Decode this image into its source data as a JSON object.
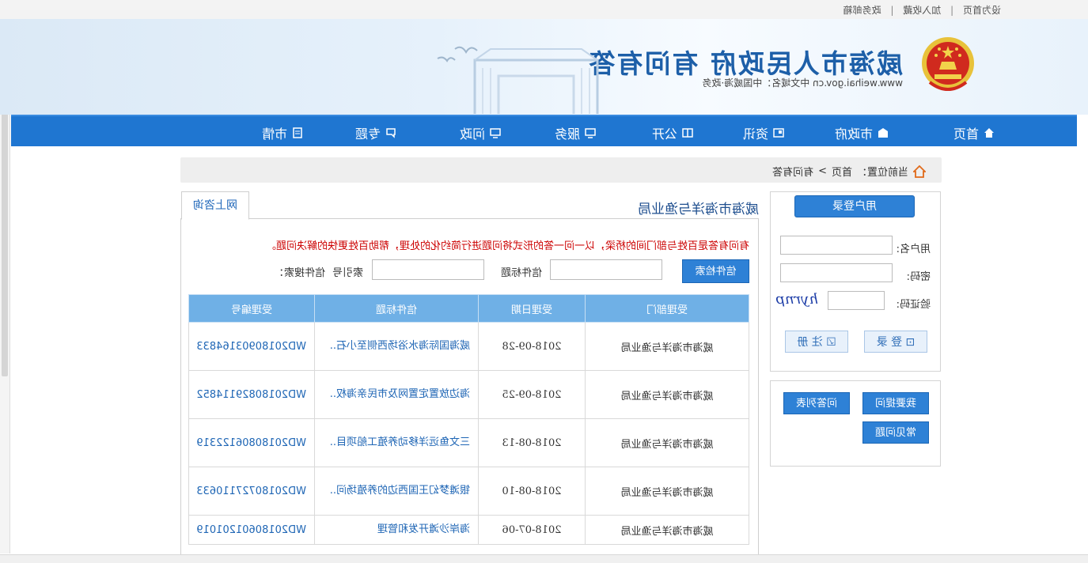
{
  "top_links": {
    "set_home": "设为首页",
    "add_fav": "加入收藏",
    "gov_mail": "政务邮箱"
  },
  "banner": {
    "title": "威海市人民政府 有问有答",
    "subtitle": "www.weihai.gov.cn   中文域名：中国威海·政务"
  },
  "nav": {
    "items": [
      "首页",
      "市政府",
      "资讯",
      "公开",
      "服务",
      "问政",
      "专题",
      "市情"
    ]
  },
  "breadcrumb": {
    "label": "当前位置：",
    "home": "首页",
    "sep": ">",
    "current": "有问有答"
  },
  "login": {
    "header": "用户登录",
    "username_label": "用户名:",
    "password_label": "密码:",
    "captcha_label": "验证码:",
    "captcha_text": "hyrnp",
    "login_button": "登 录",
    "register_button": "注 册"
  },
  "quick": {
    "ask": "我要提问",
    "faq": "常见问题",
    "list": "问答列表"
  },
  "main": {
    "tab": "网上咨询",
    "bureau": "威海市海洋与渔业局",
    "notice": "有问有答是百姓与部门间的桥梁，以一问一答的形式将问题进行简约化的处理，帮助百姓更快的解决问题。",
    "search_label": "信件搜索：",
    "index_label": "索引号",
    "title_label": "信件标题",
    "search_button": "信件检索"
  },
  "table": {
    "headers": [
      "受理编号",
      "信件标题",
      "受理日期",
      "受理部门"
    ],
    "rows": [
      {
        "code": "WD20180903164833",
        "title": "威海国际海水浴场西侧至小石..",
        "date": "2018-09-28",
        "dept": "威海市海洋与渔业局"
      },
      {
        "code": "WD20180829114852",
        "title": "海边放置定置网及市民亲海权..",
        "date": "2018-09-25",
        "dept": "威海市海洋与渔业局"
      },
      {
        "code": "WD20180806122319",
        "title": "三文鱼远洋移动养殖工船项目..",
        "date": "2018-08-13",
        "dept": "威海市海洋与渔业局"
      },
      {
        "code": "WD20180727110633",
        "title": "银滩梦幻王国西边的养殖场问..",
        "date": "2018-08-10",
        "dept": "威海市海洋与渔业局"
      },
      {
        "code": "WD20180601201019",
        "title": "海岸沙滩开发和管理",
        "date": "2018-07-06",
        "dept": "威海市海洋与渔业局"
      }
    ]
  },
  "colors": {
    "nav_blue": "#1f76d1",
    "link_blue": "#1f66b5",
    "notice_red": "#cc0000",
    "header_blue": "#6fb0e6"
  }
}
